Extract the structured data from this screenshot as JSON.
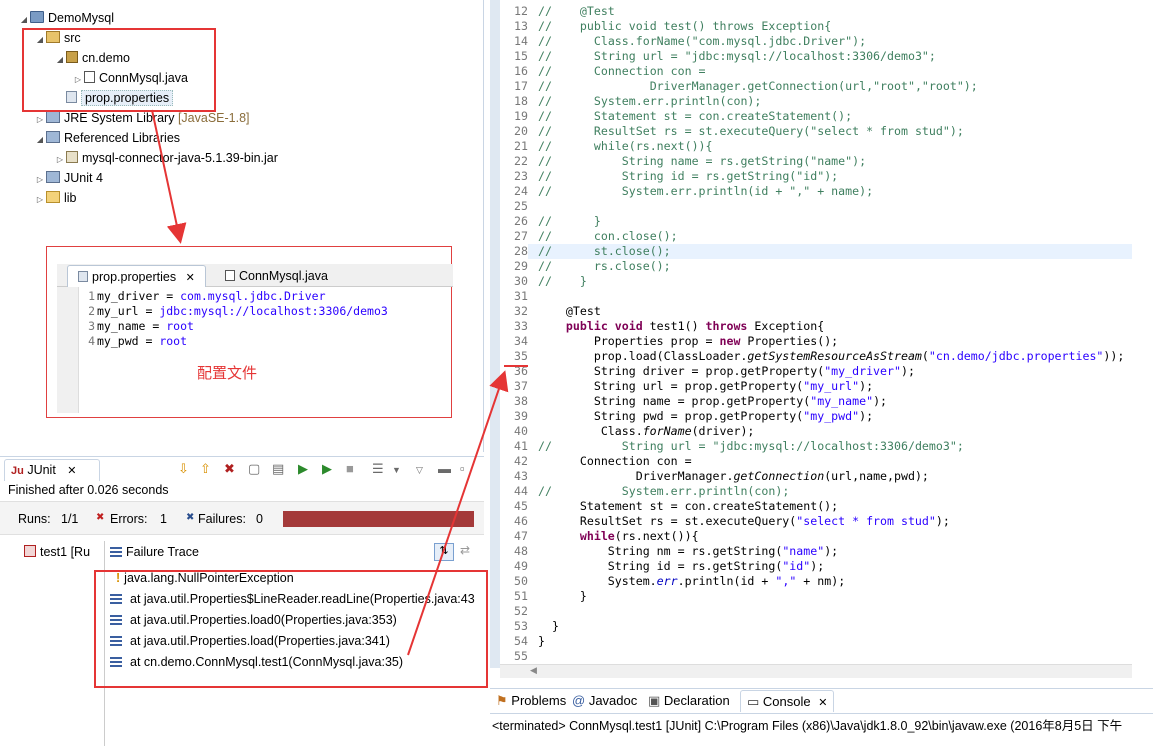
{
  "explorer": {
    "project": "DemoMysql",
    "src": "src",
    "package": "cn.demo",
    "java_file": "ConnMysql.java",
    "prop_file": "prop.properties",
    "jre": "JRE System Library",
    "jre_version": "[JavaSE-1.8]",
    "ref_libs": "Referenced Libraries",
    "jar": "mysql-connector-java-5.1.39-bin.jar",
    "junit": "JUnit 4",
    "lib": "lib"
  },
  "inset_editor": {
    "tab_active": "prop.properties",
    "tab_other": "ConnMysql.java",
    "lines": [
      {
        "num": "1",
        "key": "my_driver",
        "eq": " = ",
        "val": "com.mysql.jdbc.Driver"
      },
      {
        "num": "2",
        "key": "my_url",
        "eq": " = ",
        "val": "jdbc:mysql://localhost:3306/demo3"
      },
      {
        "num": "3",
        "key": "my_name",
        "eq": " = ",
        "val": "root"
      },
      {
        "num": "4",
        "key": "my_pwd",
        "eq": " = ",
        "val": "root"
      }
    ],
    "caption": "配置文件"
  },
  "junit": {
    "tab": "JUnit",
    "finished": "Finished after 0.026 seconds",
    "runs_label": "Runs:",
    "runs_value": "1/1",
    "errors_label": "Errors:",
    "errors_value": "1",
    "failures_label": "Failures:",
    "failures_value": "0",
    "test_item": "test1 [Ru",
    "failure_trace": "Failure Trace",
    "trace": [
      "java.lang.NullPointerException",
      "at java.util.Properties$LineReader.readLine(Properties.java:43",
      "at java.util.Properties.load0(Properties.java:353)",
      "at java.util.Properties.load(Properties.java:341)",
      "at cn.demo.ConnMysql.test1(ConnMysql.java:35)"
    ]
  },
  "code": [
    {
      "n": "12",
      "html": "<span class=\"cmt\">//</span>    <span class=\"cmt\">@Test</span>"
    },
    {
      "n": "13",
      "html": "<span class=\"cmt\">//</span>    <span class=\"cmt\">public void test() throws Exception{</span>"
    },
    {
      "n": "14",
      "html": "<span class=\"cmt\">//</span>      <span class=\"cmt\">Class.forName(\"com.mysql.jdbc.Driver\");</span>"
    },
    {
      "n": "15",
      "html": "<span class=\"cmt\">//</span>      <span class=\"cmt\">String url = \"jdbc:mysql://localhost:3306/demo3\";</span>"
    },
    {
      "n": "16",
      "html": "<span class=\"cmt\">//</span>      <span class=\"cmt\">Connection con =</span>"
    },
    {
      "n": "17",
      "html": "<span class=\"cmt\">//</span>              <span class=\"cmt\">DriverManager.getConnection(url,\"root\",\"root\");</span>"
    },
    {
      "n": "18",
      "html": "<span class=\"cmt\">//</span>      <span class=\"cmt\">System.err.println(con);</span>"
    },
    {
      "n": "19",
      "html": "<span class=\"cmt\">//</span>      <span class=\"cmt\">Statement st = con.createStatement();</span>"
    },
    {
      "n": "20",
      "html": "<span class=\"cmt\">//</span>      <span class=\"cmt\">ResultSet rs = st.executeQuery(\"select * from stud\");</span>"
    },
    {
      "n": "21",
      "html": "<span class=\"cmt\">//</span>      <span class=\"cmt\">while(rs.next()){</span>"
    },
    {
      "n": "22",
      "html": "<span class=\"cmt\">//</span>          <span class=\"cmt\">String name = rs.getString(\"name\");</span>"
    },
    {
      "n": "23",
      "html": "<span class=\"cmt\">//</span>          <span class=\"cmt\">String id = rs.getString(\"id\");</span>"
    },
    {
      "n": "24",
      "html": "<span class=\"cmt\">//</span>          <span class=\"cmt\">System.err.println(id + \",\" + name);</span>"
    },
    {
      "n": "25",
      "html": ""
    },
    {
      "n": "26",
      "html": "<span class=\"cmt\">//</span>      <span class=\"cmt\">}</span>"
    },
    {
      "n": "27",
      "html": "<span class=\"cmt\">//</span>      <span class=\"cmt\">con.close();</span>"
    },
    {
      "n": "28",
      "html": "<span class=\"cmt\">//</span>      <span class=\"cmt\">st.close();</span>"
    },
    {
      "n": "29",
      "html": "<span class=\"cmt\">//</span>      <span class=\"cmt\">rs.close();</span>"
    },
    {
      "n": "30",
      "html": "<span class=\"cmt\">//</span>    <span class=\"cmt\">}</span>"
    },
    {
      "n": "31",
      "html": ""
    },
    {
      "n": "32",
      "html": "    @Test"
    },
    {
      "n": "33",
      "html": "    <span class=\"kw\">public void</span> test1() <span class=\"kw\">throws</span> Exception{"
    },
    {
      "n": "34",
      "html": "        Properties prop = <span class=\"kw\">new</span> Properties();"
    },
    {
      "n": "35",
      "html": "        prop.load(ClassLoader.<span class=\"it\">getSystemResourceAsStream</span>(<span class=\"str\">\"cn.demo/jdbc.properties\"</span>));"
    },
    {
      "n": "36",
      "html": "        String driver = prop.getProperty(<span class=\"str\">\"my_driver\"</span>);"
    },
    {
      "n": "37",
      "html": "        String url = prop.getProperty(<span class=\"str\">\"my_url\"</span>);"
    },
    {
      "n": "38",
      "html": "        String name = prop.getProperty(<span class=\"str\">\"my_name\"</span>);"
    },
    {
      "n": "39",
      "html": "        String pwd = prop.getProperty(<span class=\"str\">\"my_pwd\"</span>);"
    },
    {
      "n": "40",
      "html": "         Class.<span class=\"it\">forName</span>(driver);"
    },
    {
      "n": "41",
      "html": "<span class=\"cmt\">//</span>          <span class=\"cmt\">String url = \"jdbc:mysql://localhost:3306/demo3\";</span>"
    },
    {
      "n": "42",
      "html": "      Connection con ="
    },
    {
      "n": "43",
      "html": "              DriverManager.<span class=\"it\">getConnection</span>(url,name,pwd);"
    },
    {
      "n": "44",
      "html": "<span class=\"cmt\">//</span>          <span class=\"cmt\">System.err.println(con);</span>"
    },
    {
      "n": "45",
      "html": "      Statement st = con.createStatement();"
    },
    {
      "n": "46",
      "html": "      ResultSet rs = st.executeQuery(<span class=\"str\">\"select * from stud\"</span>);"
    },
    {
      "n": "47",
      "html": "      <span class=\"kw\">while</span>(rs.next()){"
    },
    {
      "n": "48",
      "html": "          String nm = rs.getString(<span class=\"str\">\"name\"</span>);"
    },
    {
      "n": "49",
      "html": "          String id = rs.getString(<span class=\"str\">\"id\"</span>);"
    },
    {
      "n": "50",
      "html": "          System.<span class=\"fld\">err</span>.println(id + <span class=\"str\">\",\"</span> + nm);"
    },
    {
      "n": "51",
      "html": "      }"
    },
    {
      "n": "52",
      "html": ""
    },
    {
      "n": "53",
      "html": "  }"
    },
    {
      "n": "54",
      "html": "}"
    },
    {
      "n": "55",
      "html": ""
    }
  ],
  "console": {
    "tabs": [
      "Problems",
      "Javadoc",
      "Declaration",
      "Console"
    ],
    "status": "<terminated> ConnMysql.test1 [JUnit] C:\\Program Files (x86)\\Java\\jdk1.8.0_92\\bin\\javaw.exe (2016年8月5日 下午"
  },
  "colors": {
    "annotation_red": "#e53535",
    "junit_failure_bar": "#a43a3a",
    "keyword": "#7f0055",
    "string": "#2a00ff",
    "comment": "#3f7f5f"
  }
}
